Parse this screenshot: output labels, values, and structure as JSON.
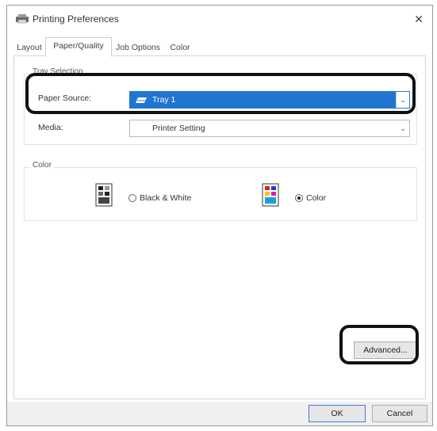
{
  "window": {
    "title": "Printing Preferences",
    "close": "✕"
  },
  "tabs": [
    {
      "label": "Layout",
      "active": false
    },
    {
      "label": "Paper/Quality",
      "active": true
    },
    {
      "label": "Job Options",
      "active": false
    },
    {
      "label": "Color",
      "active": false
    }
  ],
  "tray_group": {
    "title": "Tray Selection",
    "paper_source_label": "Paper Source:",
    "paper_source_value": "Tray 1",
    "media_label": "Media:",
    "media_value": "Printer Setting"
  },
  "color_group": {
    "title": "Color",
    "options": [
      {
        "label": "Black & White",
        "checked": false
      },
      {
        "label": "Color",
        "checked": true
      }
    ]
  },
  "buttons": {
    "advanced": "Advanced...",
    "ok": "OK",
    "cancel": "Cancel"
  },
  "colors": {
    "selection": "#1f75cf",
    "highlight": "#111111"
  }
}
